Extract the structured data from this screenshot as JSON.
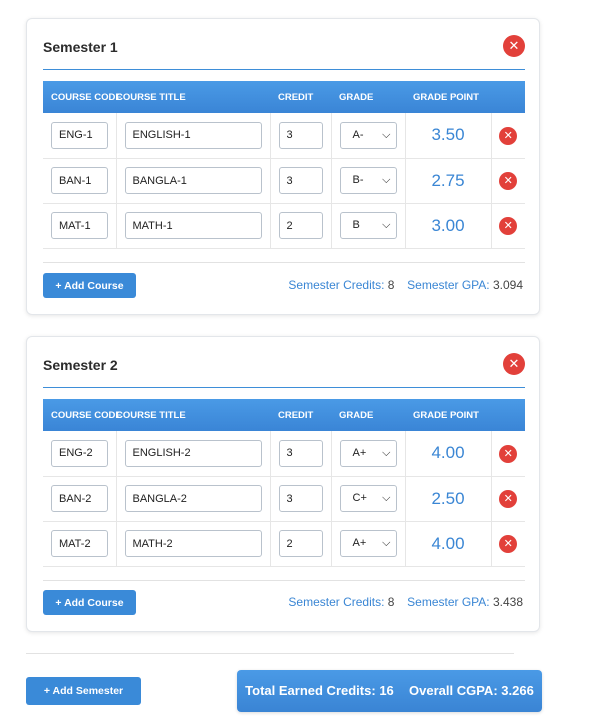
{
  "table_headers": {
    "course_code": "COURSE CODE",
    "course_title": "COURSE TITLE",
    "credit": "CREDIT",
    "grade": "GRADE",
    "grade_point": "GRADE POINT"
  },
  "icons": {
    "remove": "close-icon",
    "dropdown": "chevron-down-icon"
  },
  "colors": {
    "accent": "#3a8ad8",
    "danger": "#e2403a"
  },
  "semesters": [
    {
      "title": "Semester 1",
      "courses": [
        {
          "code": "ENG-1",
          "title": "ENGLISH-1",
          "credit": "3",
          "grade": "A-",
          "grade_point": "3.50"
        },
        {
          "code": "BAN-1",
          "title": "BANGLA-1",
          "credit": "3",
          "grade": "B-",
          "grade_point": "2.75"
        },
        {
          "code": "MAT-1",
          "title": "MATH-1",
          "credit": "2",
          "grade": "B",
          "grade_point": "3.00"
        }
      ],
      "add_course_label": "+ Add Course",
      "credits_label": "Semester Credits:",
      "credits_value": "8",
      "gpa_label": "Semester GPA:",
      "gpa_value": "3.094"
    },
    {
      "title": "Semester 2",
      "courses": [
        {
          "code": "ENG-2",
          "title": "ENGLISH-2",
          "credit": "3",
          "grade": "A+",
          "grade_point": "4.00"
        },
        {
          "code": "BAN-2",
          "title": "BANGLA-2",
          "credit": "3",
          "grade": "C+",
          "grade_point": "2.50"
        },
        {
          "code": "MAT-2",
          "title": "MATH-2",
          "credit": "2",
          "grade": "A+",
          "grade_point": "4.00"
        }
      ],
      "add_course_label": "+ Add Course",
      "credits_label": "Semester Credits:",
      "credits_value": "8",
      "gpa_label": "Semester GPA:",
      "gpa_value": "3.438"
    }
  ],
  "footer": {
    "add_semester_label": "+ Add Semester",
    "total_credits_label": "Total Earned Credits:",
    "total_credits_value": "16",
    "cgpa_label": "Overall CGPA:",
    "cgpa_value": "3.266"
  }
}
